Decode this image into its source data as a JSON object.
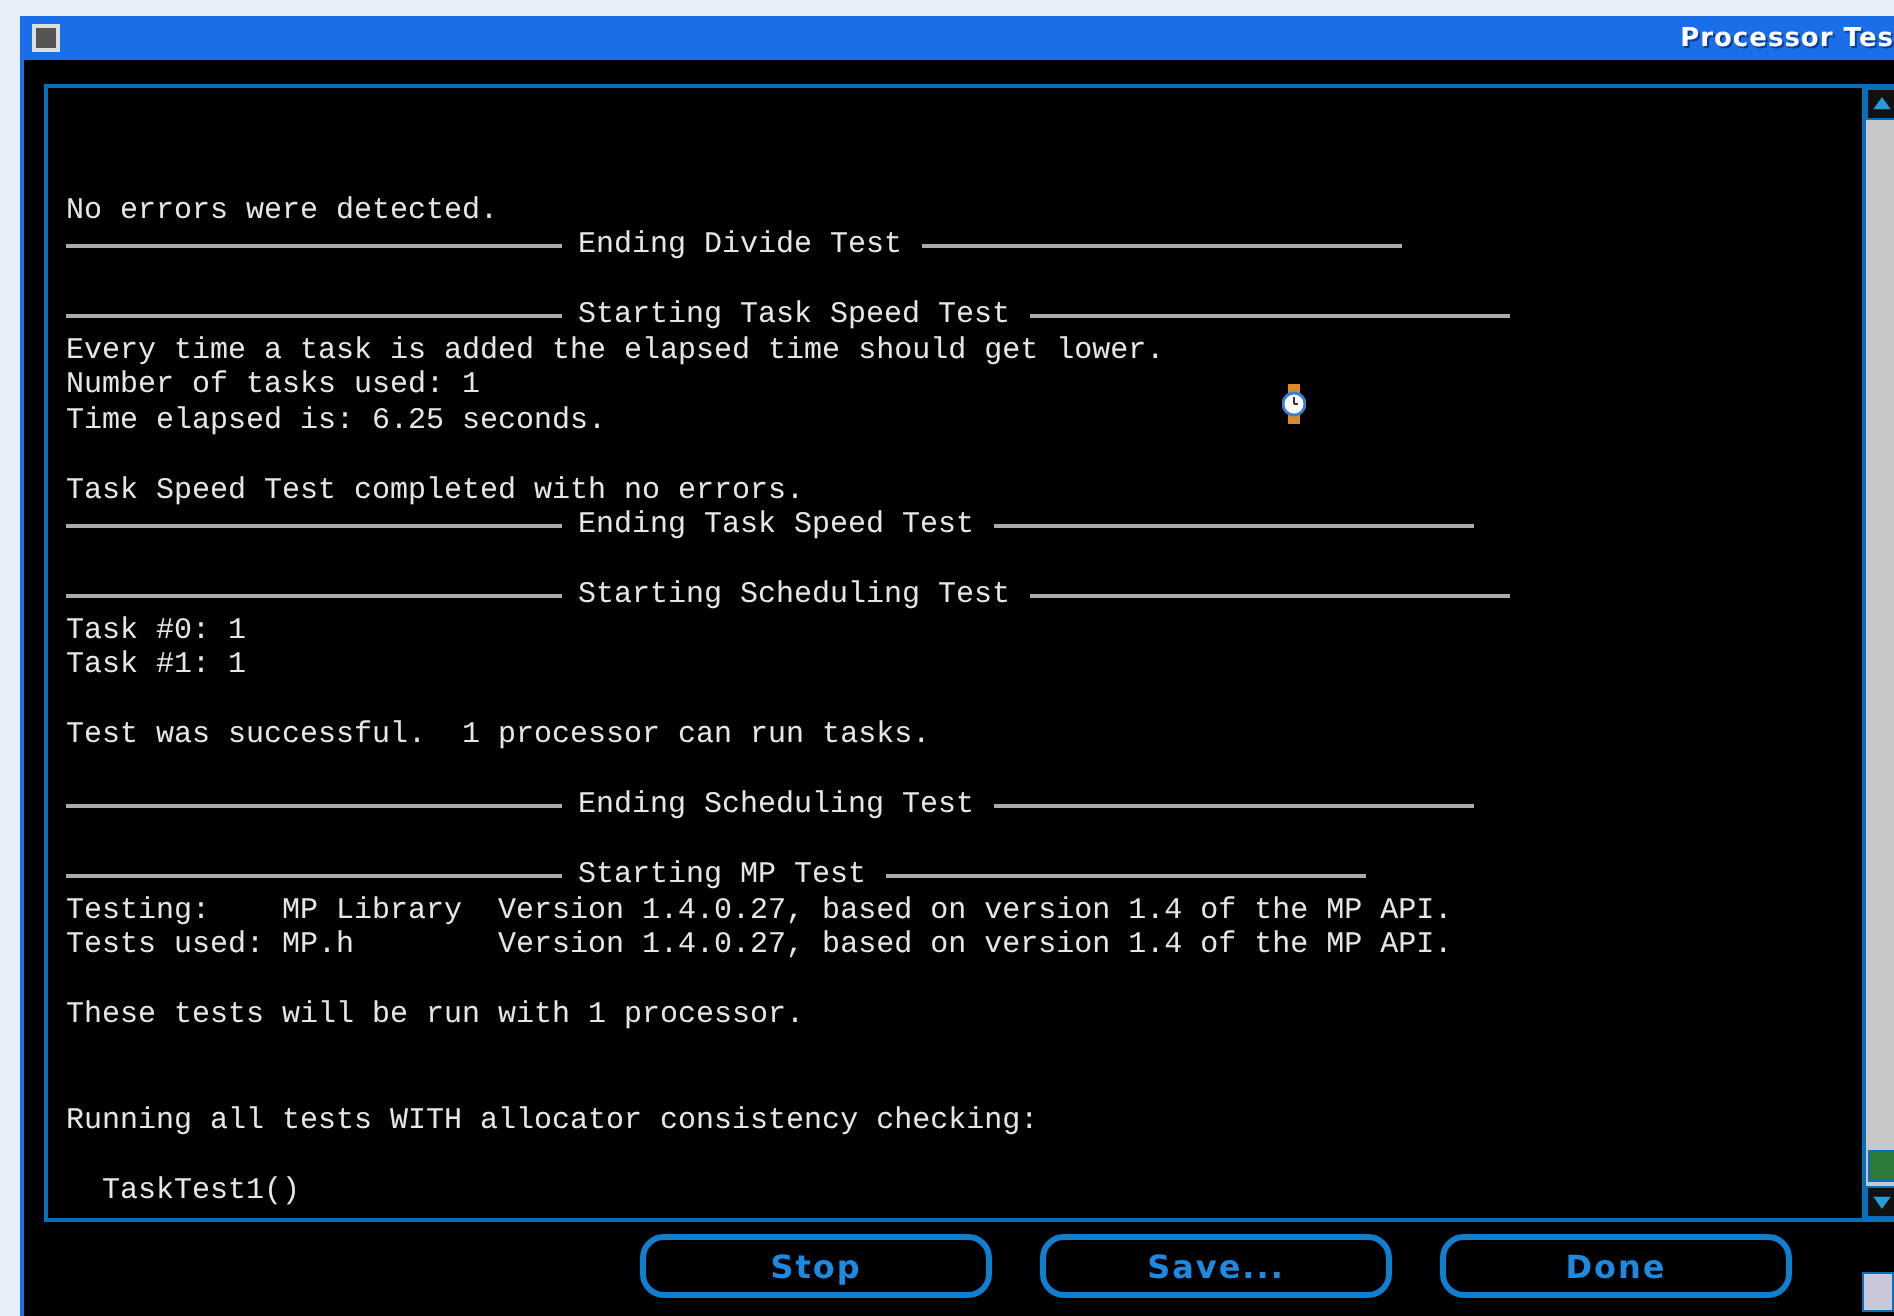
{
  "window": {
    "title": "Processor Tes"
  },
  "log": [
    {
      "kind": "blank"
    },
    {
      "kind": "blank"
    },
    {
      "kind": "blank"
    },
    {
      "kind": "text",
      "text": "No errors were detected."
    },
    {
      "kind": "rule",
      "text": "Ending Divide Test"
    },
    {
      "kind": "blank"
    },
    {
      "kind": "rule",
      "text": "Starting Task Speed Test"
    },
    {
      "kind": "text",
      "text": "Every time a task is added the elapsed time should get lower."
    },
    {
      "kind": "text",
      "text": "Number of tasks used: 1"
    },
    {
      "kind": "text",
      "text": "Time elapsed is: 6.25 seconds."
    },
    {
      "kind": "blank"
    },
    {
      "kind": "text",
      "text": "Task Speed Test completed with no errors."
    },
    {
      "kind": "rule",
      "text": "Ending Task Speed Test"
    },
    {
      "kind": "blank"
    },
    {
      "kind": "rule",
      "text": "Starting Scheduling Test"
    },
    {
      "kind": "text",
      "text": "Task #0: 1"
    },
    {
      "kind": "text",
      "text": "Task #1: 1"
    },
    {
      "kind": "blank"
    },
    {
      "kind": "text",
      "text": "Test was successful.  1 processor can run tasks."
    },
    {
      "kind": "blank"
    },
    {
      "kind": "rule",
      "text": "Ending Scheduling Test"
    },
    {
      "kind": "blank"
    },
    {
      "kind": "rule",
      "text": "Starting MP Test"
    },
    {
      "kind": "text",
      "text": "Testing:    MP Library  Version 1.4.0.27, based on version 1.4 of the MP API."
    },
    {
      "kind": "text",
      "text": "Tests used: MP.h        Version 1.4.0.27, based on version 1.4 of the MP API."
    },
    {
      "kind": "blank"
    },
    {
      "kind": "text",
      "text": "These tests will be run with 1 processor."
    },
    {
      "kind": "blank"
    },
    {
      "kind": "blank"
    },
    {
      "kind": "text",
      "text": "Running all tests WITH allocator consistency checking:"
    },
    {
      "kind": "blank"
    },
    {
      "kind": "text",
      "text": "  TaskTest1()"
    }
  ],
  "buttons": [
    "Stop",
    "Save...",
    "Done"
  ]
}
